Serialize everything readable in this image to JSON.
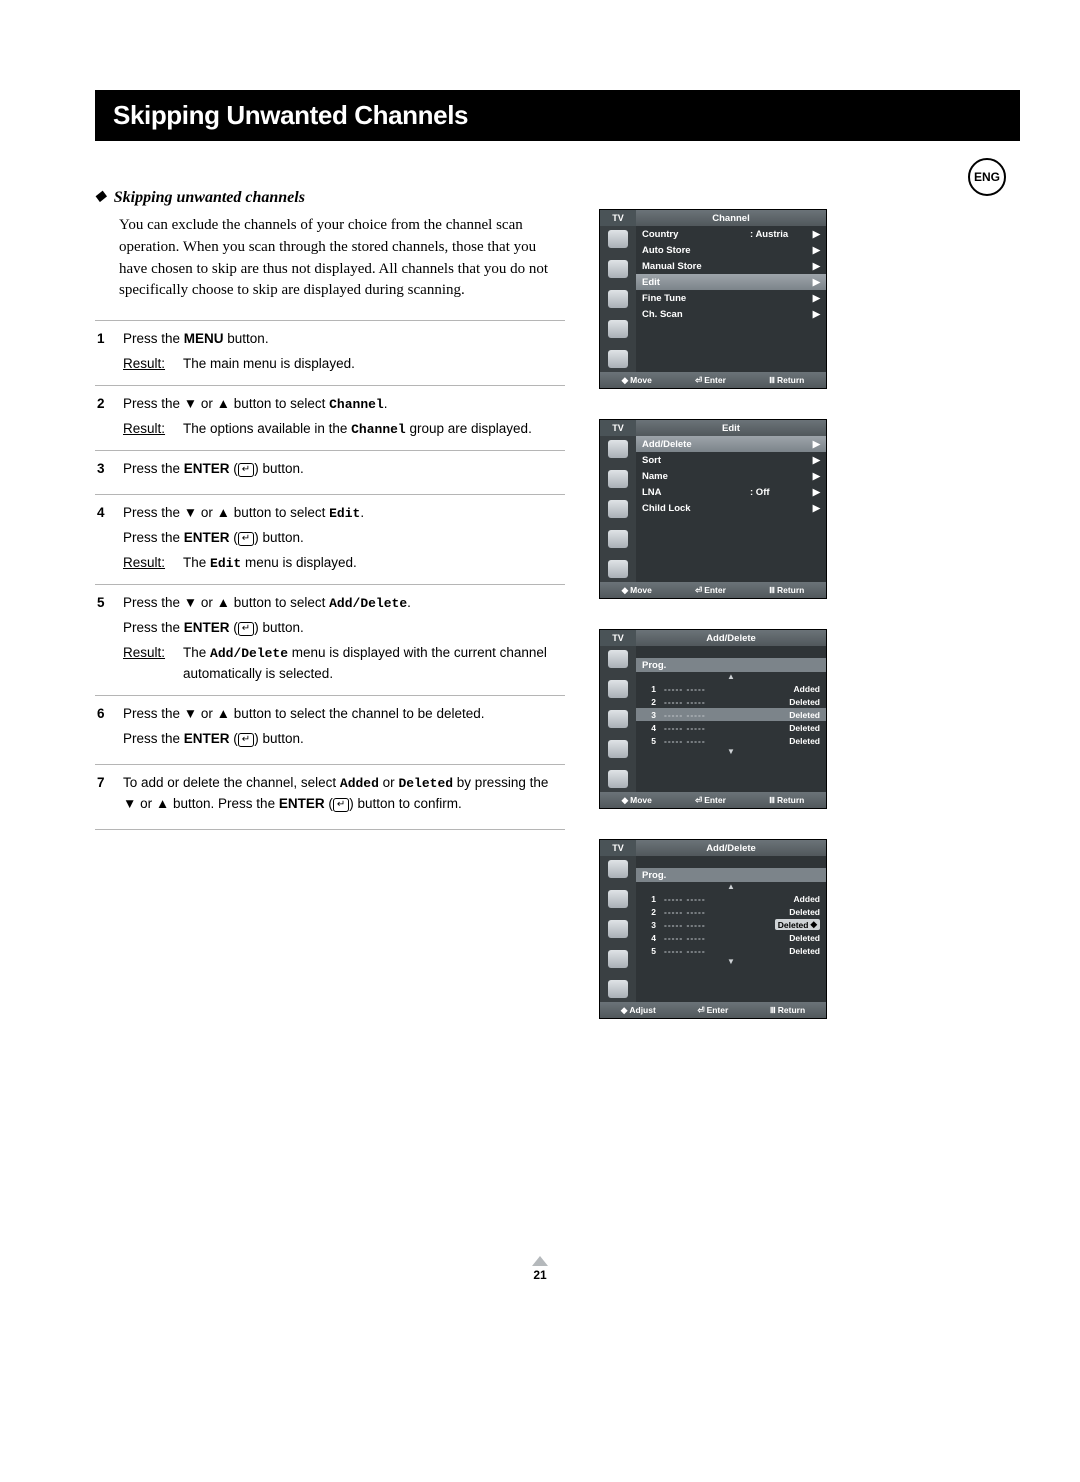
{
  "lang_badge": "ENG",
  "title": "Skipping Unwanted Channels",
  "subtitle": "Skipping unwanted channels",
  "intro": "You can exclude the channels of your choice from the channel scan operation. When you scan through the stored channels, those that you have chosen to skip are thus not displayed. All channels that you do not specifically choose to skip are displayed during scanning.",
  "result_label": "Result:",
  "steps": {
    "s1": {
      "num": "1",
      "line": "Press the MENU button.",
      "result": "The main menu is displayed."
    },
    "s2": {
      "num": "2",
      "line1a": "Press the ",
      "line1b": " or ",
      "line1c": " button to select ",
      "line1_mono": "Channel",
      "result_a": "The options available in the ",
      "result_mono": "Channel",
      "result_b": " group are displayed."
    },
    "s3": {
      "num": "3",
      "line_a": "Press the ",
      "line_b": "ENTER",
      "line_c": " button."
    },
    "s4": {
      "num": "4",
      "l1a": "Press the ",
      "l1b": " or ",
      "l1c": " button to select ",
      "l1_mono": "Edit",
      "l2a": "Press the ",
      "l2b": "ENTER",
      "l2c": " button.",
      "result_a": "The ",
      "result_mono": "Edit",
      "result_b": " menu is displayed."
    },
    "s5": {
      "num": "5",
      "l1a": "Press the ",
      "l1b": " or ",
      "l1c": " button to select ",
      "l1_mono": "Add/Delete",
      "l2a": "Press the ",
      "l2b": "ENTER",
      "l2c": " button.",
      "result_a": "The ",
      "result_mono": "Add/Delete",
      "result_b": " menu is displayed with the current channel automatically  is selected."
    },
    "s6": {
      "num": "6",
      "l1a": "Press the ",
      "l1b": " or ",
      "l1c": " button to select the channel to be deleted.",
      "l2a": "Press the ",
      "l2b": "ENTER",
      "l2c": " button."
    },
    "s7": {
      "num": "7",
      "a": "To add or delete the channel, select ",
      "m1": "Added",
      "b": " or ",
      "m2": "Deleted",
      "c": " by pressing the ",
      "d": " or ",
      "e": " button. Press the ",
      "f": "ENTER",
      "g": " button to confirm."
    }
  },
  "osd_common": {
    "tv": "TV",
    "move": "Move",
    "adjust": "Adjust",
    "enter": "Enter",
    "return": "Return",
    "prog": "Prog."
  },
  "osd1": {
    "title": "Channel",
    "rows": [
      {
        "lbl": "Country",
        "val": ":  Austria",
        "arr": "▶",
        "hl": false
      },
      {
        "lbl": "Auto Store",
        "val": "",
        "arr": "▶",
        "hl": false
      },
      {
        "lbl": "Manual Store",
        "val": "",
        "arr": "▶",
        "hl": false
      },
      {
        "lbl": "Edit",
        "val": "",
        "arr": "▶",
        "hl": true
      },
      {
        "lbl": "Fine Tune",
        "val": "",
        "arr": "▶",
        "hl": false
      },
      {
        "lbl": "Ch. Scan",
        "val": "",
        "arr": "▶",
        "hl": false
      }
    ]
  },
  "osd2": {
    "title": "Edit",
    "rows": [
      {
        "lbl": "Add/Delete",
        "val": "",
        "arr": "▶",
        "hl": true
      },
      {
        "lbl": "Sort",
        "val": "",
        "arr": "▶",
        "hl": false
      },
      {
        "lbl": "Name",
        "val": "",
        "arr": "▶",
        "hl": false
      },
      {
        "lbl": "LNA",
        "val": ":  Off",
        "arr": "▶",
        "hl": false
      },
      {
        "lbl": "Child Lock",
        "val": "",
        "arr": "▶",
        "hl": false
      }
    ]
  },
  "osd3": {
    "title": "Add/Delete",
    "rows": [
      {
        "n": "1",
        "d": "-----  -----",
        "s": "Added",
        "hl": false,
        "pill": false
      },
      {
        "n": "2",
        "d": "-----  -----",
        "s": "Deleted",
        "hl": false,
        "pill": false
      },
      {
        "n": "3",
        "d": "-----  -----",
        "s": "Deleted",
        "hl": true,
        "pill": false
      },
      {
        "n": "4",
        "d": "-----  -----",
        "s": "Deleted",
        "hl": false,
        "pill": false
      },
      {
        "n": "5",
        "d": "-----  -----",
        "s": "Deleted",
        "hl": false,
        "pill": false
      }
    ],
    "footer": "move"
  },
  "osd4": {
    "title": "Add/Delete",
    "rows": [
      {
        "n": "1",
        "d": "-----  -----",
        "s": "Added",
        "hl": false,
        "pill": false
      },
      {
        "n": "2",
        "d": "-----  -----",
        "s": "Deleted",
        "hl": false,
        "pill": false
      },
      {
        "n": "3",
        "d": "-----  -----",
        "s": "Deleted",
        "hl": false,
        "pill": true
      },
      {
        "n": "4",
        "d": "-----  -----",
        "s": "Deleted",
        "hl": false,
        "pill": false
      },
      {
        "n": "5",
        "d": "-----  -----",
        "s": "Deleted",
        "hl": false,
        "pill": false
      }
    ],
    "footer": "adjust"
  },
  "page_number": "21"
}
